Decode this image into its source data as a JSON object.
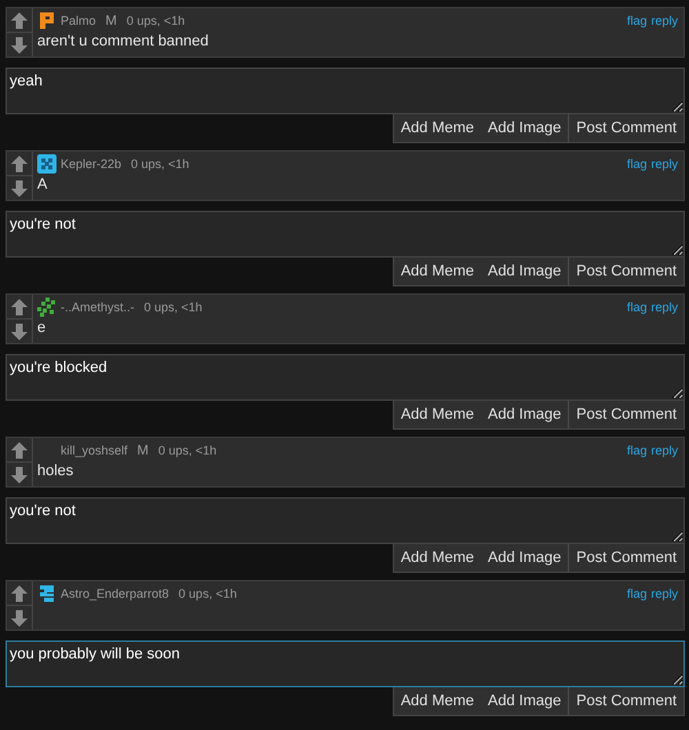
{
  "threads": [
    {
      "comment": {
        "avatar": {
          "kind": "letter",
          "color": "#f08a1c"
        },
        "username": "Palmo",
        "badge": "M",
        "meta": "0 ups, <1h",
        "body": "aren't u comment banned",
        "links": [
          "flag",
          "reply"
        ]
      },
      "reply": {
        "value": "yeah",
        "focused": false
      },
      "buttons": [
        "Add Meme",
        "Add Image",
        "Post Comment"
      ]
    },
    {
      "comment": {
        "avatar": {
          "kind": "checker",
          "color": "#2fb6e8"
        },
        "username": "Kepler-22b",
        "meta": "0 ups, <1h",
        "body": "A",
        "links": [
          "flag",
          "reply"
        ]
      },
      "reply": {
        "value": "you're not",
        "focused": false
      },
      "buttons": [
        "Add Meme",
        "Add Image",
        "Post Comment"
      ]
    },
    {
      "comment": {
        "avatar": {
          "kind": "dots",
          "color": "#3fae3a"
        },
        "username": "-..Amethyst..-",
        "meta": "0 ups, <1h",
        "body": "e",
        "links": [
          "flag",
          "reply"
        ]
      },
      "reply": {
        "value": "you're blocked",
        "focused": false
      },
      "buttons": [
        "Add Meme",
        "Add Image",
        "Post Comment"
      ]
    },
    {
      "comment": {
        "username": "kill_yoshself",
        "badge": "M",
        "meta": "0 ups, <1h",
        "body": "holes",
        "links": [
          "flag",
          "reply"
        ]
      },
      "reply": {
        "value": "you're not",
        "focused": false
      },
      "buttons": [
        "Add Meme",
        "Add Image",
        "Post Comment"
      ]
    },
    {
      "comment": {
        "avatar": {
          "kind": "shape",
          "color": "#2fb6e8"
        },
        "username": "Astro_Enderparrot8",
        "meta": "0 ups, <1h",
        "links": [
          "flag",
          "reply"
        ]
      },
      "reply": {
        "value": "you probably will be soon",
        "focused": true
      },
      "buttons": [
        "Add Meme",
        "Add Image",
        "Post Comment"
      ]
    }
  ]
}
